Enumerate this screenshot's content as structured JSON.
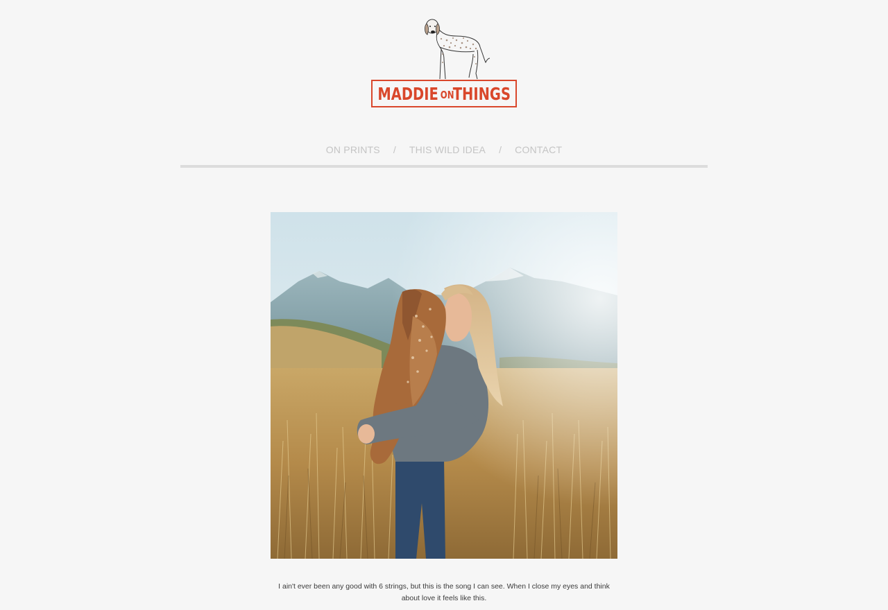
{
  "site": {
    "logo": {
      "word1": "MADDIE",
      "word2": "ON",
      "word3": "THINGS",
      "brand_color": "#d9472b",
      "icon": "dog-illustration"
    }
  },
  "nav": {
    "items": [
      {
        "label": "ON PRINTS"
      },
      {
        "label": "THIS WILD IDEA"
      },
      {
        "label": "CONTACT"
      }
    ],
    "separator": "/"
  },
  "post": {
    "photo": {
      "icon": "photo-woman-hugging-dog-in-meadow"
    },
    "caption": "I ain't ever been any good with 6 strings, but this is the song I can see. When I close my eyes and think about love it feels like this."
  },
  "colors": {
    "background": "#f6f6f6",
    "accent": "#d9472b",
    "nav_text": "#c4c4c4",
    "nav_rule": "#dcdcdc"
  }
}
